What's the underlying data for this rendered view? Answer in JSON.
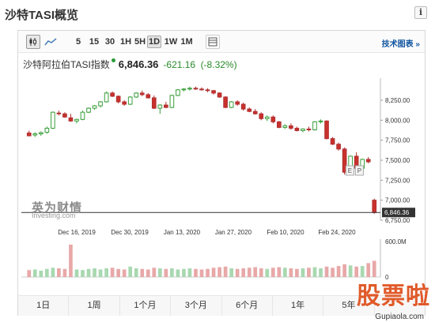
{
  "header": {
    "title": "沙特TASI概览",
    "info_icon": "info-icon"
  },
  "toolbar": {
    "chart_icons": [
      "candlestick-icon",
      "area-chart-icon"
    ],
    "periods": [
      "5",
      "15",
      "30",
      "1H",
      "5H",
      "1D",
      "1W",
      "1M"
    ],
    "active_period": "1D",
    "table_icon": "table-icon",
    "tech_link": "技术图表 »"
  },
  "instrument": {
    "name": "沙特阿拉伯TASI指数",
    "price": "6,846.36",
    "change": "-621.16",
    "change_pct": "(-8.32%)"
  },
  "watermark": {
    "logo": "英为财情",
    "sub": "Investing.com"
  },
  "markers": [
    "E",
    "P"
  ],
  "range_tabs": [
    "1日",
    "1周",
    "1个月",
    "3个月",
    "6个月",
    "1年",
    "5年"
  ],
  "stamp": {
    "text": "股票啦",
    "url": "Gupiaola.com"
  },
  "colors": {
    "up": "#3a9e3a",
    "down": "#b03030",
    "up_fill": "#5cb85c",
    "down_fill": "#c9302c",
    "vol_up": "#a8d8b0",
    "vol_down": "#e8a8a8",
    "price_tag_bg": "#333333"
  },
  "chart_data": {
    "type": "candlestick",
    "y_ticks": [
      "8,250.00",
      "8,000.00",
      "7,750.00",
      "7,500.00",
      "7,250.00",
      "7,000.00",
      "6,750.00"
    ],
    "ylim": [
      6750,
      8250
    ],
    "x_ticks": [
      "Dec 16, 2019",
      "Dec 30, 2019",
      "Jan 13, 2020",
      "Jan 27, 2020",
      "Feb 10, 2020",
      "Feb 24, 2020"
    ],
    "last_price_label": "6,846.36",
    "volume_ticks": [
      "600.0M",
      "0"
    ],
    "volume_ylim": [
      0,
      600
    ],
    "candles": [
      {
        "o": 7840,
        "h": 7870,
        "l": 7800,
        "c": 7805
      },
      {
        "o": 7815,
        "h": 7850,
        "l": 7790,
        "c": 7830
      },
      {
        "o": 7830,
        "h": 7860,
        "l": 7805,
        "c": 7845
      },
      {
        "o": 7850,
        "h": 7920,
        "l": 7830,
        "c": 7900
      },
      {
        "o": 7900,
        "h": 8110,
        "l": 7890,
        "c": 8100
      },
      {
        "o": 8090,
        "h": 8120,
        "l": 8060,
        "c": 8080
      },
      {
        "o": 8080,
        "h": 8100,
        "l": 8030,
        "c": 8040
      },
      {
        "o": 8030,
        "h": 8080,
        "l": 7980,
        "c": 7990
      },
      {
        "o": 7990,
        "h": 8020,
        "l": 7960,
        "c": 8010
      },
      {
        "o": 8010,
        "h": 8120,
        "l": 8000,
        "c": 8100
      },
      {
        "o": 8100,
        "h": 8160,
        "l": 8090,
        "c": 8150
      },
      {
        "o": 8150,
        "h": 8190,
        "l": 8130,
        "c": 8180
      },
      {
        "o": 8180,
        "h": 8240,
        "l": 8160,
        "c": 8230
      },
      {
        "o": 8230,
        "h": 8360,
        "l": 8220,
        "c": 8340
      },
      {
        "o": 8340,
        "h": 8360,
        "l": 8290,
        "c": 8300
      },
      {
        "o": 8300,
        "h": 8310,
        "l": 8210,
        "c": 8230
      },
      {
        "o": 8230,
        "h": 8250,
        "l": 8180,
        "c": 8200
      },
      {
        "o": 8200,
        "h": 8300,
        "l": 8190,
        "c": 8290
      },
      {
        "o": 8290,
        "h": 8350,
        "l": 8280,
        "c": 8340
      },
      {
        "o": 8340,
        "h": 8370,
        "l": 8300,
        "c": 8320
      },
      {
        "o": 8320,
        "h": 8340,
        "l": 8270,
        "c": 8280
      },
      {
        "o": 8280,
        "h": 8310,
        "l": 8140,
        "c": 8150
      },
      {
        "o": 8150,
        "h": 8200,
        "l": 8080,
        "c": 8190
      },
      {
        "o": 8190,
        "h": 8230,
        "l": 8150,
        "c": 8160
      },
      {
        "o": 8160,
        "h": 8320,
        "l": 8150,
        "c": 8310
      },
      {
        "o": 8310,
        "h": 8390,
        "l": 8300,
        "c": 8380
      },
      {
        "o": 8380,
        "h": 8400,
        "l": 8360,
        "c": 8390
      },
      {
        "o": 8390,
        "h": 8420,
        "l": 8370,
        "c": 8400
      },
      {
        "o": 8400,
        "h": 8420,
        "l": 8380,
        "c": 8390
      },
      {
        "o": 8390,
        "h": 8410,
        "l": 8370,
        "c": 8380
      },
      {
        "o": 8380,
        "h": 8400,
        "l": 8350,
        "c": 8370
      },
      {
        "o": 8370,
        "h": 8380,
        "l": 8320,
        "c": 8340
      },
      {
        "o": 8340,
        "h": 8350,
        "l": 8280,
        "c": 8290
      },
      {
        "o": 8290,
        "h": 8300,
        "l": 8150,
        "c": 8160
      },
      {
        "o": 8160,
        "h": 8240,
        "l": 8150,
        "c": 8230
      },
      {
        "o": 8230,
        "h": 8250,
        "l": 8180,
        "c": 8200
      },
      {
        "o": 8200,
        "h": 8220,
        "l": 8120,
        "c": 8140
      },
      {
        "o": 8140,
        "h": 8160,
        "l": 8100,
        "c": 8110
      },
      {
        "o": 8110,
        "h": 8140,
        "l": 8070,
        "c": 8080
      },
      {
        "o": 8080,
        "h": 8100,
        "l": 8000,
        "c": 8020
      },
      {
        "o": 8020,
        "h": 8060,
        "l": 7990,
        "c": 8040
      },
      {
        "o": 8040,
        "h": 8060,
        "l": 7960,
        "c": 7980
      },
      {
        "o": 7980,
        "h": 7990,
        "l": 7900,
        "c": 7910
      },
      {
        "o": 7910,
        "h": 7950,
        "l": 7890,
        "c": 7930
      },
      {
        "o": 7930,
        "h": 7960,
        "l": 7880,
        "c": 7900
      },
      {
        "o": 7900,
        "h": 7920,
        "l": 7860,
        "c": 7870
      },
      {
        "o": 7870,
        "h": 7900,
        "l": 7850,
        "c": 7890
      },
      {
        "o": 7890,
        "h": 7920,
        "l": 7860,
        "c": 7880
      },
      {
        "o": 7880,
        "h": 7990,
        "l": 7870,
        "c": 7980
      },
      {
        "o": 7980,
        "h": 8010,
        "l": 7960,
        "c": 7990
      },
      {
        "o": 7990,
        "h": 8000,
        "l": 7760,
        "c": 7770
      },
      {
        "o": 7770,
        "h": 7790,
        "l": 7690,
        "c": 7700
      },
      {
        "o": 7700,
        "h": 7720,
        "l": 7620,
        "c": 7640
      },
      {
        "o": 7640,
        "h": 7660,
        "l": 7320,
        "c": 7350
      },
      {
        "o": 7350,
        "h": 7560,
        "l": 7340,
        "c": 7550
      },
      {
        "o": 7550,
        "h": 7600,
        "l": 7380,
        "c": 7400
      },
      {
        "o": 7400,
        "h": 7520,
        "l": 7390,
        "c": 7510
      },
      {
        "o": 7510,
        "h": 7540,
        "l": 7460,
        "c": 7480
      },
      {
        "o": 7000,
        "h": 7020,
        "l": 6830,
        "c": 6846
      }
    ],
    "volumes": [
      120,
      130,
      110,
      140,
      160,
      150,
      140,
      200,
      130,
      120,
      140,
      150,
      130,
      150,
      160,
      140,
      130,
      180,
      150,
      140,
      130,
      160,
      150,
      140,
      150,
      130,
      140,
      150,
      140,
      130,
      140,
      160,
      170,
      180,
      150,
      140,
      150,
      160,
      170,
      150,
      140,
      160,
      170,
      160,
      150,
      140,
      150,
      160,
      170,
      150,
      180,
      160,
      190,
      220,
      200,
      180,
      190,
      240,
      280
    ],
    "vol_spikes": {
      "7": 560
    }
  }
}
